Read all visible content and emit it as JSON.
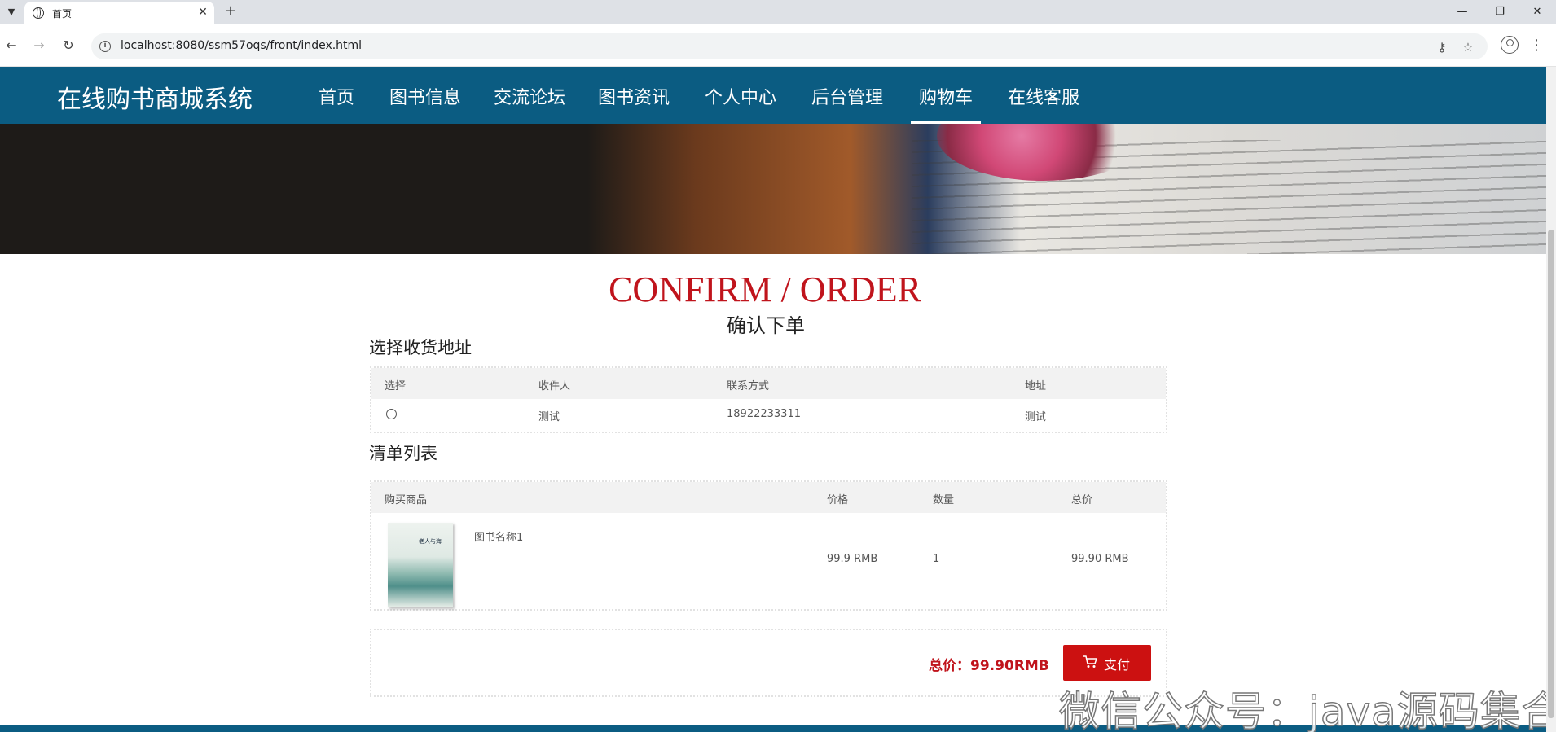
{
  "browser": {
    "tab_title": "首页",
    "url": "localhost:8080/ssm57oqs/front/index.html"
  },
  "site": {
    "title": "在线购书商城系统",
    "menu": [
      "首页",
      "图书信息",
      "交流论坛",
      "图书资讯",
      "个人中心",
      "后台管理",
      "购物车",
      "在线客服"
    ],
    "active_menu": "购物车"
  },
  "page": {
    "heading_en": "CONFIRM / ORDER",
    "heading_cn": "确认下单"
  },
  "address_section": {
    "title": "选择收货地址",
    "columns": [
      "选择",
      "收件人",
      "联系方式",
      "地址"
    ],
    "rows": [
      {
        "recipient": "测试",
        "phone": "18922233311",
        "address": "测试"
      }
    ]
  },
  "order_section": {
    "title": "清单列表",
    "columns": [
      "购买商品",
      "价格",
      "数量",
      "总价"
    ],
    "items": [
      {
        "name": "图书名称1",
        "price": "99.9 RMB",
        "quantity": "1",
        "total": "99.90 RMB",
        "cover_text": "老人与海"
      }
    ]
  },
  "summary": {
    "total_label": "总价：99.90RMB",
    "pay_label": "支付"
  },
  "watermark": "微信公众号：java源码集合"
}
